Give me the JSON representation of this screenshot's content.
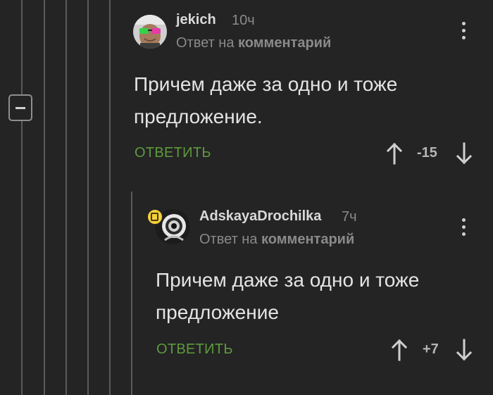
{
  "comments": [
    {
      "username": "jekich",
      "time": "10ч",
      "reply_prefix": "Ответ на",
      "reply_target": "комментарий",
      "text": "Причем даже за одно и тоже предложение.",
      "reply_label": "ОТВЕТИТЬ",
      "rating": "-15"
    },
    {
      "username": "AdskayaDrochilka",
      "time": "7ч",
      "reply_prefix": "Ответ на",
      "reply_target": "комментарий",
      "text": "Причем даже за одно и тоже предложение",
      "reply_label": "ОТВЕТИТЬ",
      "rating": "+7"
    }
  ],
  "icons": {
    "collapse": "minus-icon",
    "menu": "more-vertical-icon",
    "upvote": "arrow-up-icon",
    "downvote": "arrow-down-icon"
  },
  "colors": {
    "background": "#242424",
    "accent_green": "#5e9a3c",
    "text": "#e4e4e4",
    "muted": "#8a8a8a"
  }
}
